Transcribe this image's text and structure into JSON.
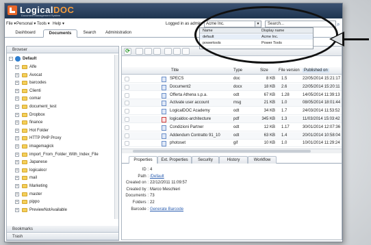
{
  "app": {
    "name_part1": "Logical",
    "name_part2": "DOC",
    "subtitle": "Document Management System"
  },
  "menu": {
    "items": [
      "File ▾",
      "Personal ▾",
      "Tools ▾",
      "Help ▾"
    ],
    "logged_in": "Logged in as admin"
  },
  "tenant_select": {
    "value": "Acme Inc."
  },
  "search": {
    "placeholder": "Search..."
  },
  "tabs": [
    "Dashboard",
    "Documents",
    "Search",
    "Administration"
  ],
  "tenant_popup": {
    "headers": [
      "Name",
      "Display name"
    ],
    "rows": [
      {
        "name": "default",
        "display": "Acme Inc."
      },
      {
        "name": "powertools",
        "display": "Power Tools"
      }
    ]
  },
  "left_panel": {
    "browser": "Browser",
    "bookmarks": "Bookmarks",
    "trash": "Trash",
    "root": "Default",
    "folders": [
      "Alfe",
      "Avocat",
      "barcodes",
      "Clienti",
      "comar",
      "document_test",
      "Dropbox",
      "finance",
      "Hot Folder",
      "HTTP PHP Proxy",
      "imagemagick",
      "import_From_Folder_With_Index_File",
      "Japanese",
      "logicalocr",
      "mail",
      "Marketing",
      "master",
      "pippo",
      "PreviewNotAvailable"
    ]
  },
  "grid": {
    "columns": [
      "Title",
      "Type",
      "Size",
      "File version",
      "Published on"
    ],
    "rows": [
      {
        "title": "SPECS",
        "type": "doc",
        "size": "8 KB",
        "ver": "1.5",
        "pub": "22/05/2014 15:21:17"
      },
      {
        "title": "Document2",
        "type": "docx",
        "size": "18 KB",
        "ver": "2.6",
        "pub": "22/05/2014 15:20:11"
      },
      {
        "title": "Offerta Athena s.p.a.",
        "type": "odt",
        "size": "67 KB",
        "ver": "1.28",
        "pub": "14/05/2014 11:39:13"
      },
      {
        "title": "Activate user account",
        "type": "msg",
        "size": "21 KB",
        "ver": "1.0",
        "pub": "08/05/2014 18:01:44"
      },
      {
        "title": "LogicalDOC Academy",
        "type": "odt",
        "size": "34 KB",
        "ver": "1.7",
        "pub": "24/03/2014 11:53:52"
      },
      {
        "title": "logicaldoc-architecture",
        "type": "pdf",
        "size": "345 KB",
        "ver": "1.3",
        "pub": "11/03/2014 15:03:42"
      },
      {
        "title": "Condizioni Partner",
        "type": "odt",
        "size": "12 KB",
        "ver": "1.17",
        "pub": "30/01/2014 12:07:36"
      },
      {
        "title": "Addendum Contratto 91_10",
        "type": "odt",
        "size": "63 KB",
        "ver": "1.4",
        "pub": "20/01/2014 10:58:04"
      },
      {
        "title": "photoset",
        "type": "gif",
        "size": "10 KB",
        "ver": "1.0",
        "pub": "10/01/2014 11:29:24"
      }
    ]
  },
  "detail_tabs": [
    "Properties",
    "Ext. Properties",
    "Security",
    "History",
    "Workflow"
  ],
  "properties": [
    {
      "label": "ID :",
      "value": "4"
    },
    {
      "label": "Path :",
      "value": "/Default",
      "link": true
    },
    {
      "label": "Created on :",
      "value": "22/12/2011 11:09:57"
    },
    {
      "label": "Created by :",
      "value": "Marco Meschieri"
    },
    {
      "label": "Documents :",
      "value": "73"
    },
    {
      "label": "Folders :",
      "value": "22"
    },
    {
      "label": "Barcode :",
      "value": "Generate Barcode",
      "link": true
    }
  ]
}
